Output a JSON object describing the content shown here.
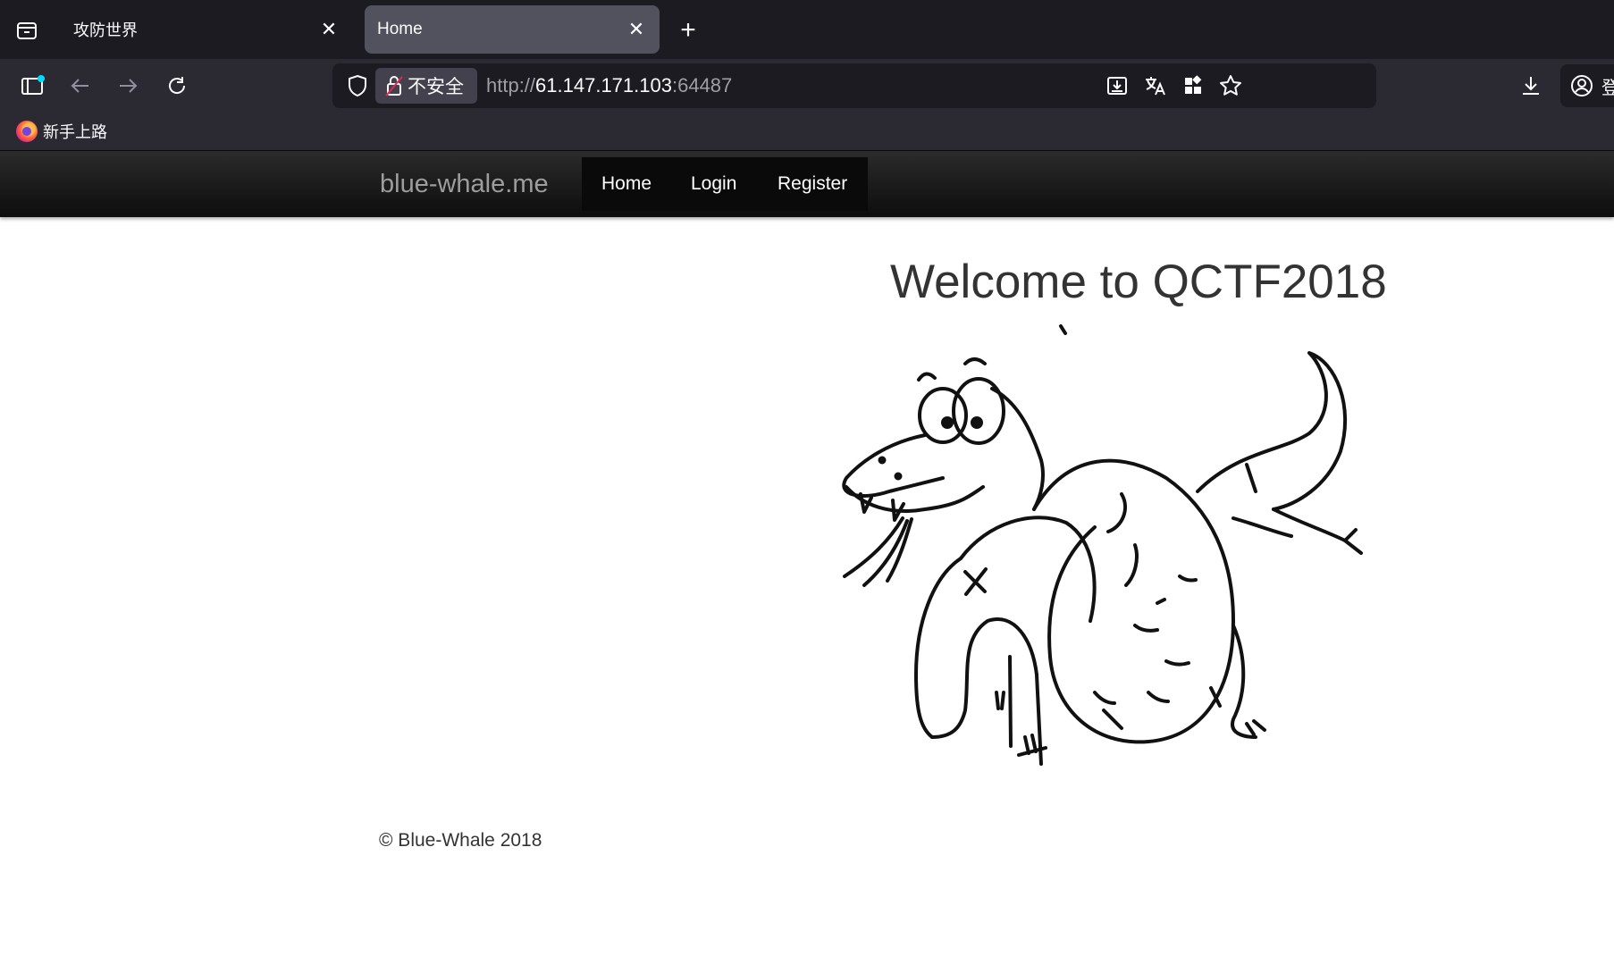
{
  "browser": {
    "tabs": [
      {
        "title": "攻防世界",
        "active": false
      },
      {
        "title": "Home",
        "active": true
      }
    ],
    "security_label": "不安全",
    "url_scheme": "http://",
    "url_host": "61.147.171.103",
    "url_port": ":64487",
    "account_label": "登",
    "bookmarks": [
      {
        "label": "新手上路"
      }
    ]
  },
  "site": {
    "brand": "blue-whale.me",
    "menu": {
      "home": "Home",
      "login": "Login",
      "register": "Register"
    },
    "heading": "Welcome to QCTF2018",
    "footer": "© Blue-Whale 2018"
  },
  "colors": {
    "chrome_dark": "#1c1b22",
    "chrome_toolbar": "#2b2a33",
    "active_tab": "#52525e",
    "site_navbar": "#222222",
    "brand_text": "#9d9d9d",
    "body_text": "#333333"
  },
  "icons": [
    "tab-overview-icon",
    "close-icon",
    "plus-icon",
    "sidebar-icon",
    "back-arrow-icon",
    "forward-arrow-icon",
    "reload-icon",
    "shield-icon",
    "insecure-lock-icon",
    "save-to-device-icon",
    "translate-icon",
    "extensions-grid-icon",
    "star-icon",
    "download-icon",
    "account-icon",
    "firefox-icon"
  ]
}
